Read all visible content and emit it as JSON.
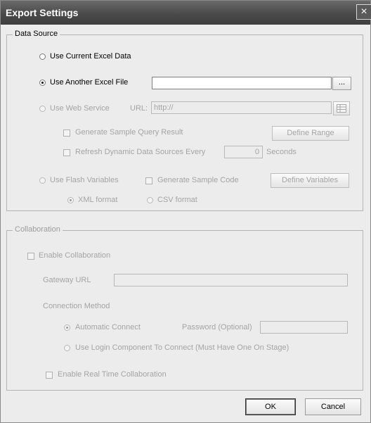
{
  "window": {
    "title": "Export Settings",
    "close_symbol": "×"
  },
  "data_source": {
    "legend": "Data Source",
    "use_current_excel": "Use Current Excel Data",
    "use_another_excel": "Use Another Excel File",
    "another_excel_value": "",
    "browse_label": "...",
    "use_web_service": "Use Web Service",
    "url_label": "URL:",
    "url_value": "http://",
    "generate_sample_query": "Generate Sample Query Result",
    "define_range": "Define Range",
    "refresh_dynamic": "Refresh Dynamic Data Sources Every",
    "refresh_value": "0",
    "seconds_label": "Seconds",
    "use_flash_variables": "Use Flash Variables",
    "generate_sample_code": "Generate Sample Code",
    "define_variables": "Define Variables",
    "xml_format": "XML format",
    "csv_format": "CSV format"
  },
  "collaboration": {
    "legend": "Collaboration",
    "enable_collaboration": "Enable Collaboration",
    "gateway_url_label": "Gateway URL",
    "gateway_url_value": "",
    "connection_method_label": "Connection Method",
    "automatic_connect": "Automatic Connect",
    "password_label": "Password (Optional)",
    "password_value": "",
    "use_login_component": "Use Login Component To Connect (Must Have One On Stage)",
    "enable_real_time": "Enable Real Time Collaboration"
  },
  "footer": {
    "ok_label": "OK",
    "cancel_label": "Cancel"
  }
}
